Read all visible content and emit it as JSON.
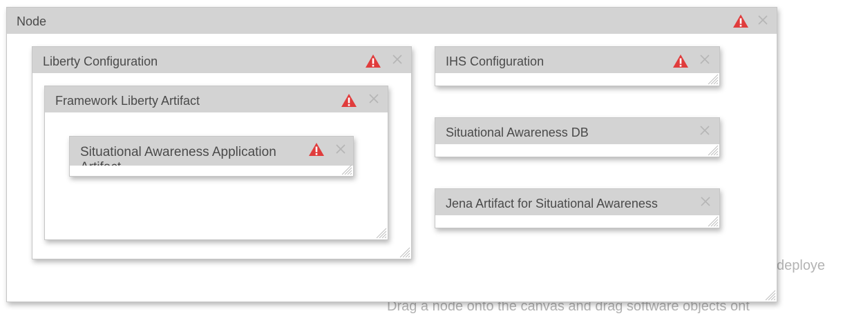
{
  "node": {
    "title": "Node",
    "children": {
      "liberty": {
        "title": "Liberty Configuration",
        "framework": {
          "title": "Framework Liberty Artifact",
          "app": {
            "title": "Situational Awareness Application Artifact"
          }
        }
      },
      "ihs": {
        "title": "IHS Configuration"
      },
      "db": {
        "title": "Situational Awareness DB"
      },
      "jena": {
        "title": "Jena Artifact for Situational Awareness"
      }
    }
  },
  "hints": {
    "line1": "deploye",
    "line2": "Drag a node onto the canvas and drag software objects ont"
  },
  "icons": {
    "warning": "warning-triangle-icon",
    "close": "close-x-icon",
    "resize": "resize-grip-icon"
  },
  "colors": {
    "header_bg": "#d3d3d3",
    "warning_red": "#e03c3c",
    "close_gray": "#b5b5b5",
    "hint_gray": "#b3b3b3"
  }
}
